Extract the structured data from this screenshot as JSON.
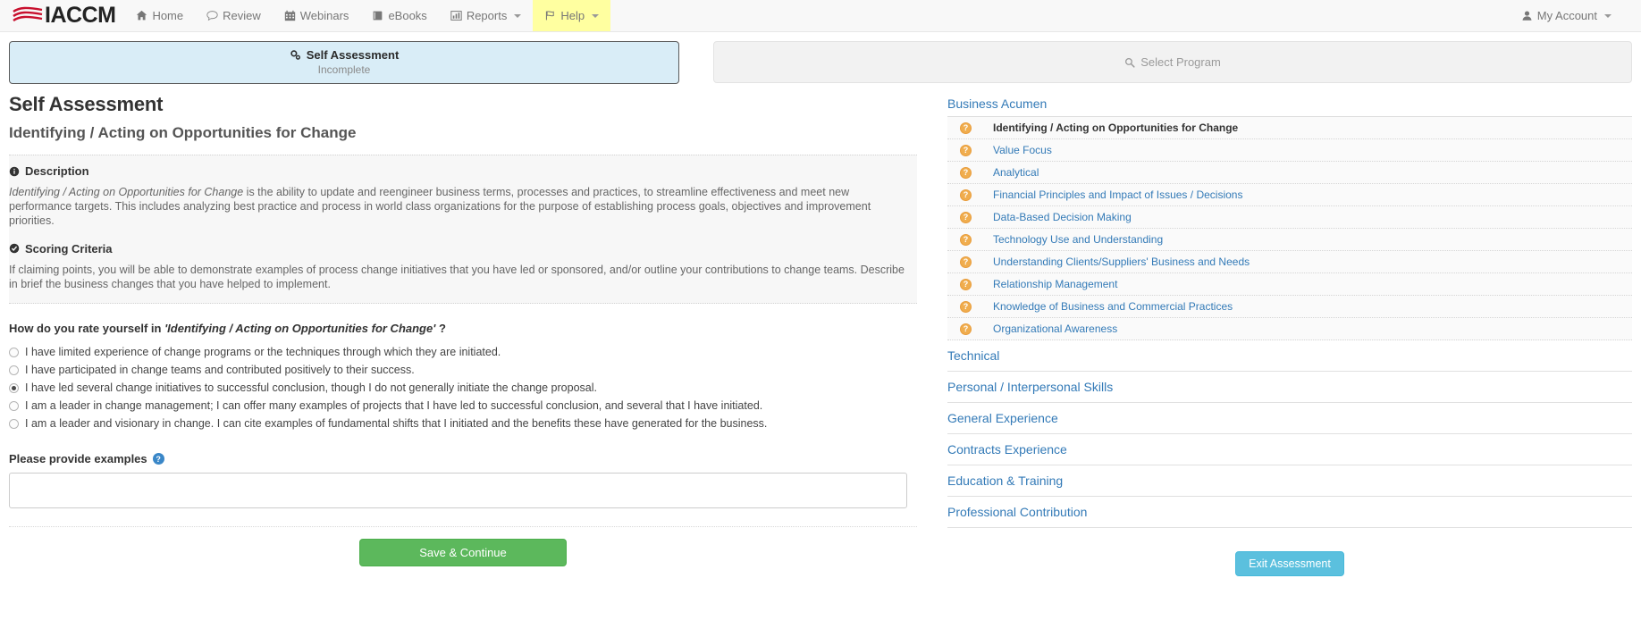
{
  "navbar": {
    "brand": "IACCM",
    "brand_icon": "waves-logo-icon",
    "items": [
      {
        "label": "Home",
        "icon": "home-icon",
        "caret": false,
        "active": false
      },
      {
        "label": "Review",
        "icon": "comment-icon",
        "caret": false,
        "active": false
      },
      {
        "label": "Webinars",
        "icon": "calendar-icon",
        "caret": false,
        "active": false
      },
      {
        "label": "eBooks",
        "icon": "book-icon",
        "caret": false,
        "active": false
      },
      {
        "label": "Reports",
        "icon": "chart-bar-icon",
        "caret": true,
        "active": false
      },
      {
        "label": "Help",
        "icon": "flag-icon",
        "caret": true,
        "active": true
      }
    ],
    "account": {
      "label": "My Account",
      "icon": "user-icon",
      "caret": true
    }
  },
  "tabs": {
    "assessment": {
      "title": "Self Assessment",
      "status": "Incomplete",
      "icon": "gears-icon"
    },
    "program": {
      "label": "Select Program",
      "icon": "search-icon"
    }
  },
  "main": {
    "title": "Self Assessment",
    "subtitle": "Identifying / Acting on Opportunities for Change",
    "description": {
      "heading": "Description",
      "icon": "info-circle-icon",
      "emphasis": "Identifying / Acting on Opportunities for Change",
      "text": " is the ability to update and reengineer business terms, processes and practices, to streamline effectiveness and meet new performance targets. This includes analyzing best practice and process in world class organizations for the purpose of establishing process goals, objectives and improvement priorities."
    },
    "scoring": {
      "heading": "Scoring Criteria",
      "icon": "check-circle-icon",
      "text": "If claiming points, you will be able to demonstrate examples of process change initiatives that you have led or sponsored, and/or outline your contributions to change teams. Describe in brief the business changes that you have helped to implement."
    },
    "question": {
      "prefix": "How do you rate yourself in ",
      "emphasis": "'Identifying / Acting on Opportunities for Change'",
      "suffix": " ?"
    },
    "options": [
      {
        "label": "I have limited experience of change programs or the techniques through which they are initiated.",
        "selected": false
      },
      {
        "label": "I have participated in change teams and contributed positively to their success.",
        "selected": false
      },
      {
        "label": "I have led several change initiatives to successful conclusion, though I do not generally initiate the change proposal.",
        "selected": true
      },
      {
        "label": "I am a leader in change management; I can offer many examples of projects that I have led to successful conclusion, and several that I have initiated.",
        "selected": false
      },
      {
        "label": "I am a leader and visionary in change. I can cite examples of fundamental shifts that I initiated and the benefits these have generated for the business.",
        "selected": false
      }
    ],
    "examples": {
      "label": "Please provide examples",
      "help_icon": "question-circle-icon",
      "help_glyph": "?",
      "value": "",
      "placeholder": ""
    },
    "save_button": "Save & Continue"
  },
  "sidebar": {
    "groups": [
      {
        "label": "Business Acumen",
        "expanded": true,
        "items": [
          {
            "label": "Identifying / Acting on Opportunities for Change",
            "active": true,
            "icon": "question-badge-icon",
            "glyph": "?"
          },
          {
            "label": "Value Focus",
            "active": false,
            "icon": "question-badge-icon",
            "glyph": "?"
          },
          {
            "label": "Analytical",
            "active": false,
            "icon": "question-badge-icon",
            "glyph": "?"
          },
          {
            "label": "Financial Principles and Impact of Issues / Decisions",
            "active": false,
            "icon": "question-badge-icon",
            "glyph": "?"
          },
          {
            "label": "Data-Based Decision Making",
            "active": false,
            "icon": "question-badge-icon",
            "glyph": "?"
          },
          {
            "label": "Technology Use and Understanding",
            "active": false,
            "icon": "question-badge-icon",
            "glyph": "?"
          },
          {
            "label": "Understanding Clients/Suppliers' Business and Needs",
            "active": false,
            "icon": "question-badge-icon",
            "glyph": "?"
          },
          {
            "label": "Relationship Management",
            "active": false,
            "icon": "question-badge-icon",
            "glyph": "?"
          },
          {
            "label": "Knowledge of Business and Commercial Practices",
            "active": false,
            "icon": "question-badge-icon",
            "glyph": "?"
          },
          {
            "label": "Organizational Awareness",
            "active": false,
            "icon": "question-badge-icon",
            "glyph": "?"
          }
        ]
      },
      {
        "label": "Technical",
        "expanded": false,
        "items": []
      },
      {
        "label": "Personal / Interpersonal Skills",
        "expanded": false,
        "items": []
      },
      {
        "label": "General Experience",
        "expanded": false,
        "items": []
      },
      {
        "label": "Contracts Experience",
        "expanded": false,
        "items": []
      },
      {
        "label": "Education & Training",
        "expanded": false,
        "items": []
      },
      {
        "label": "Professional Contribution",
        "expanded": false,
        "items": []
      }
    ],
    "exit_button": "Exit Assessment"
  },
  "colors": {
    "brand_red": "#c8102e",
    "tab_blue_bg": "#d9edf7",
    "link_blue": "#337ab7",
    "badge_orange": "#f0ad4e",
    "save_green": "#5cb85c",
    "exit_blue": "#5bc0de",
    "help_highlight": "#ffffa0"
  }
}
